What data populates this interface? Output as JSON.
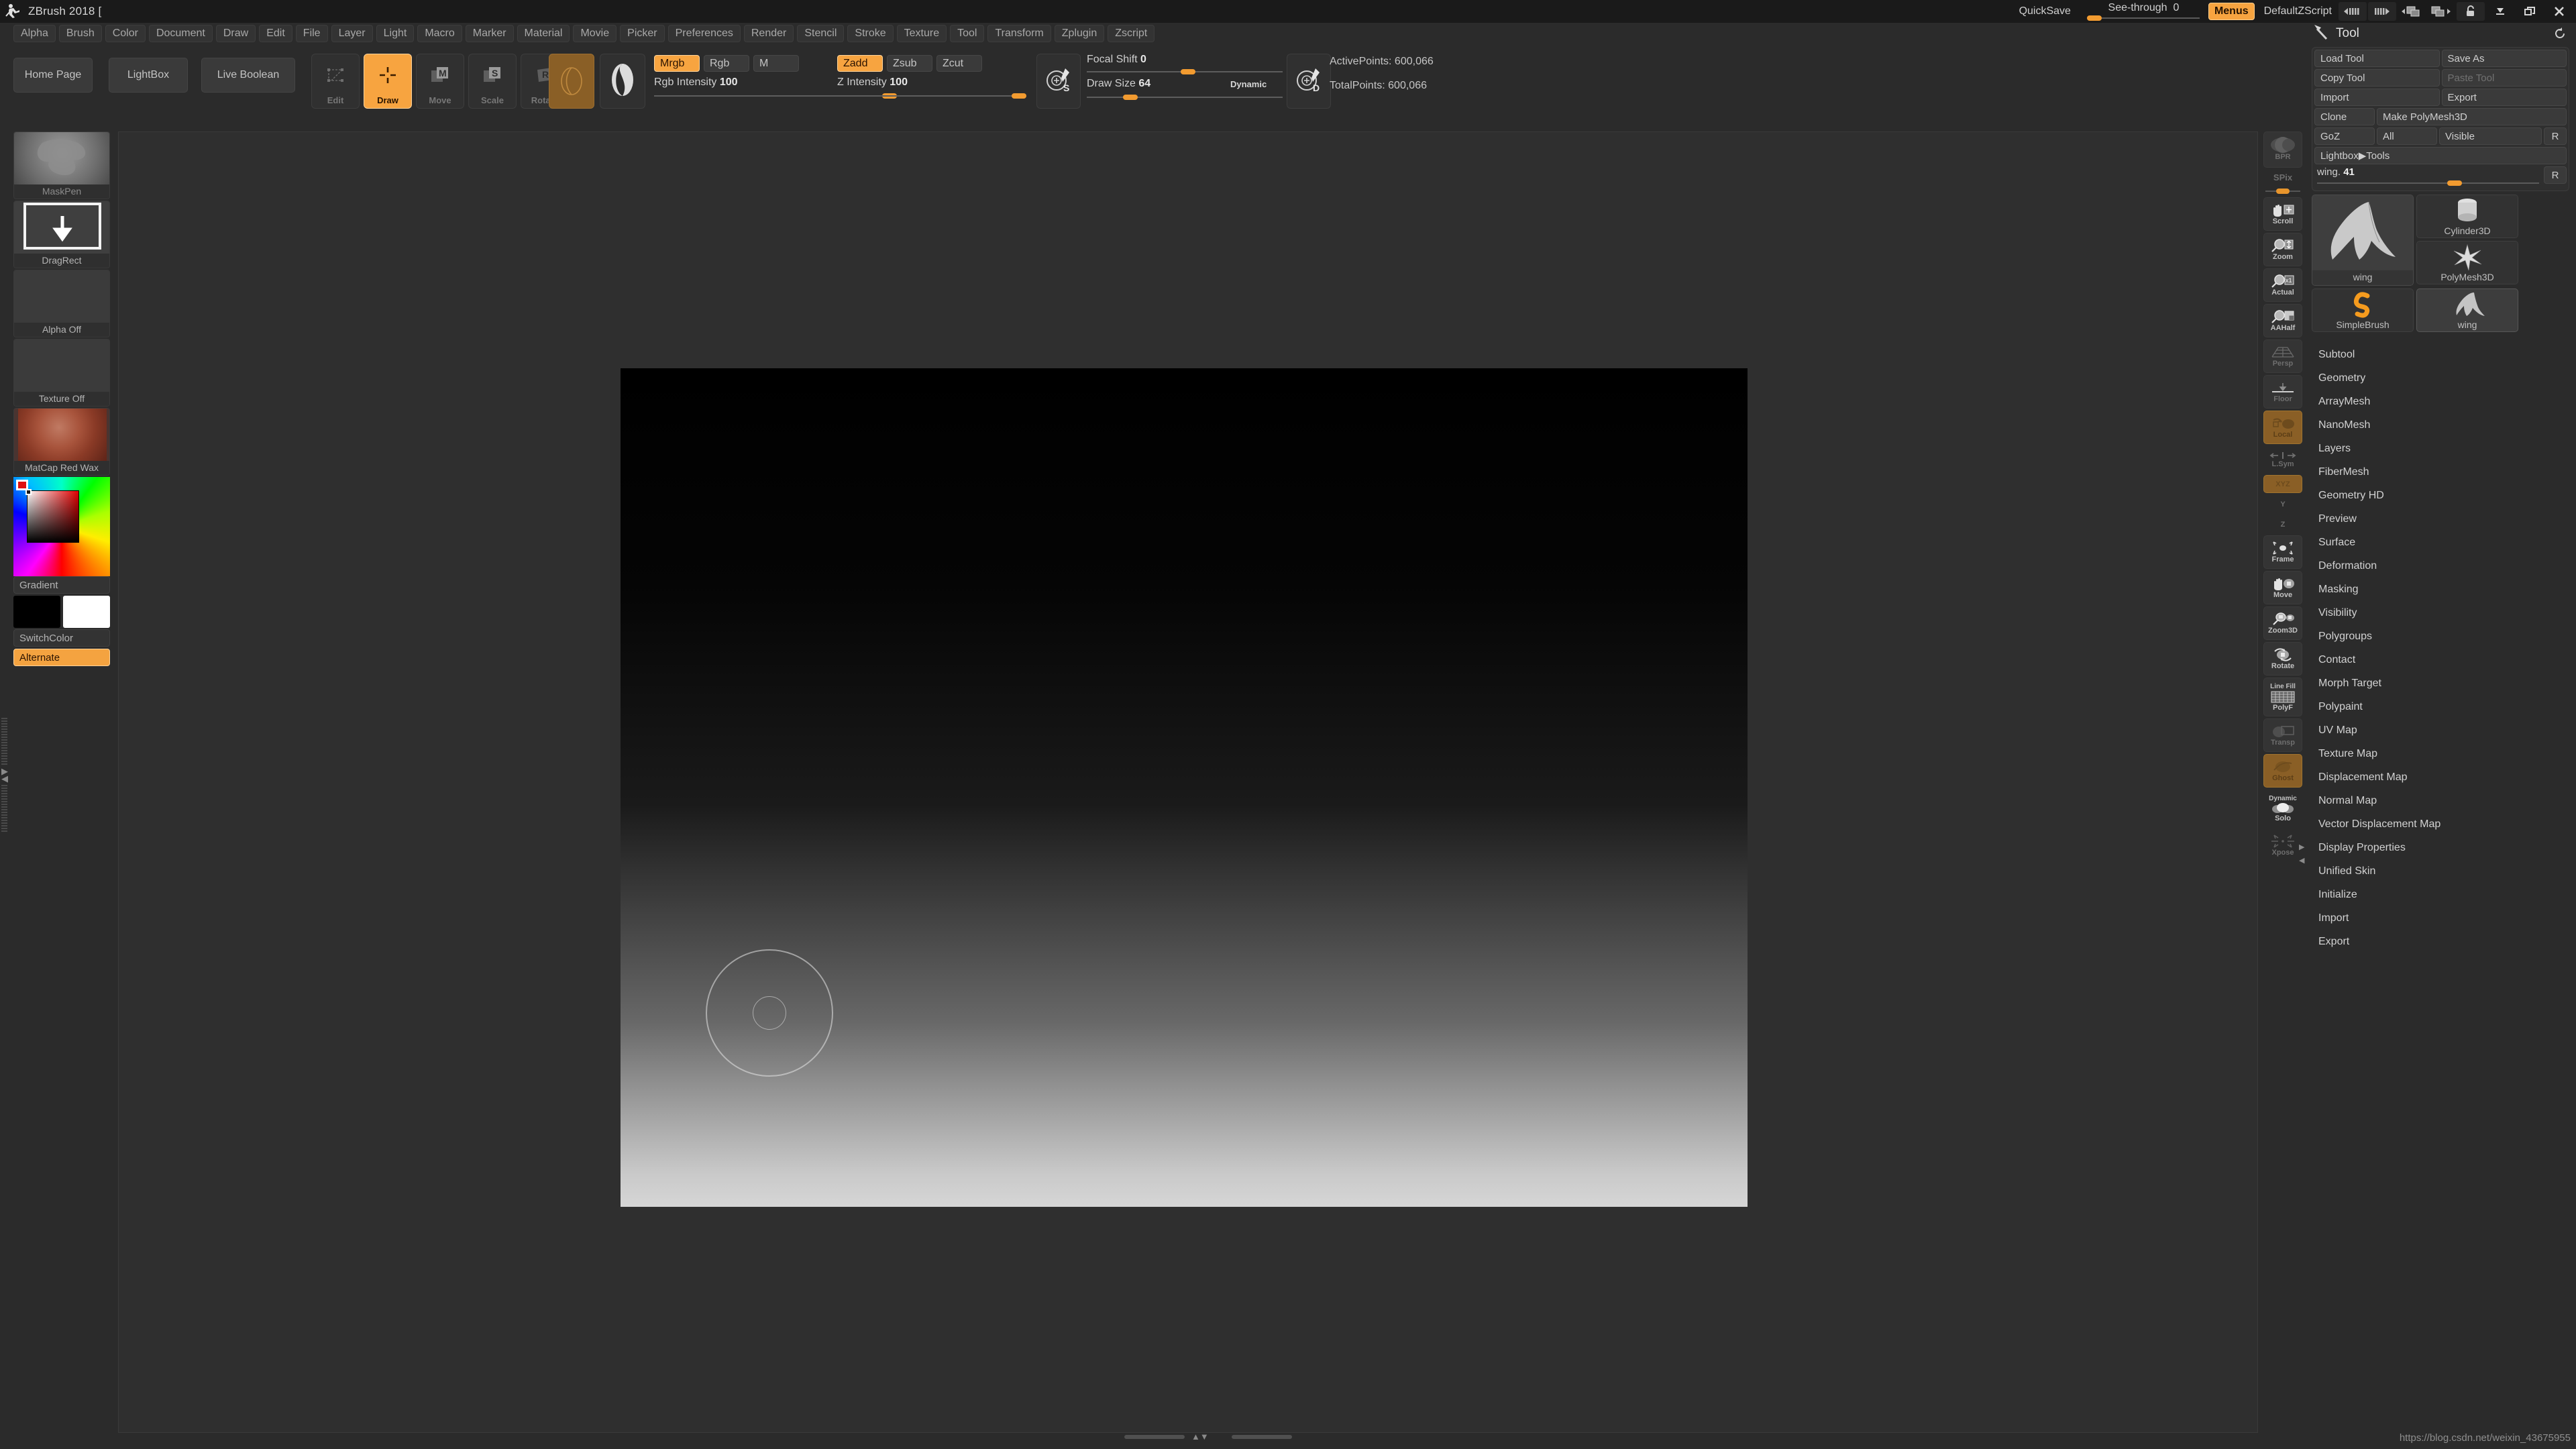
{
  "titlebar": {
    "app_title": "ZBrush 2018 [",
    "logo_icon": "zbrush-runner-logo",
    "quicksave": "QuickSave",
    "see_through_label": "See-through",
    "see_through_value": "0",
    "menus_label": "Menus",
    "default_zscript": "DefaultZScript",
    "window_icons": [
      "prev-shelf-icon",
      "next-shelf-icon",
      "prev-panel-icon",
      "next-panel-icon",
      "lock-icon",
      "minimize-icon",
      "restore-icon",
      "close-icon"
    ]
  },
  "menubar": {
    "items": [
      "Alpha",
      "Brush",
      "Color",
      "Document",
      "Draw",
      "Edit",
      "File",
      "Layer",
      "Light",
      "Macro",
      "Marker",
      "Material",
      "Movie",
      "Picker",
      "Preferences",
      "Render",
      "Stencil",
      "Stroke",
      "Texture",
      "Tool",
      "Transform",
      "Zplugin",
      "Zscript"
    ]
  },
  "shelf": {
    "home_page": "Home Page",
    "lightbox": "LightBox",
    "live_boolean": "Live Boolean",
    "modes": [
      {
        "label": "Edit",
        "icon": "edit-mode-icon",
        "active": false
      },
      {
        "label": "Draw",
        "icon": "draw-mode-icon",
        "active": true
      },
      {
        "label": "Move",
        "icon": "move-mode-icon",
        "active": false
      },
      {
        "label": "Scale",
        "icon": "scale-mode-icon",
        "active": false
      },
      {
        "label": "Rotate",
        "icon": "rotate-mode-icon",
        "active": false
      }
    ],
    "brush_swatch_icon": "current-brush-icon",
    "stroke_swatch_icon": "current-stroke-icon",
    "rgb_toggles": [
      {
        "label": "Mrgb",
        "on": true
      },
      {
        "label": "Rgb",
        "on": false
      },
      {
        "label": "M",
        "on": false
      }
    ],
    "rgb_intensity_label": "Rgb Intensity",
    "rgb_intensity_value": "100",
    "z_toggles": [
      {
        "label": "Zadd",
        "on": true
      },
      {
        "label": "Zsub",
        "on": false
      },
      {
        "label": "Zcut",
        "on": false
      }
    ],
    "z_intensity_label": "Z Intensity",
    "z_intensity_value": "100",
    "focal_shift_label": "Focal Shift",
    "focal_shift_value": "0",
    "draw_size_label": "Draw Size",
    "draw_size_value": "64",
    "dynamic_label": "Dynamic",
    "s_icon": "brush-size-s-icon",
    "d_icon": "brush-size-d-icon",
    "active_points": "ActivePoints: 600,066",
    "total_points": "TotalPoints: 600,066"
  },
  "left_palette": {
    "items": [
      {
        "name": "MaskPen",
        "icon": "brush-thumb-maskpen",
        "dim": true
      },
      {
        "name": "DragRect",
        "icon": "stroke-thumb-dragrect",
        "dim": false
      },
      {
        "name": "Alpha Off",
        "icon": "alpha-thumb-off",
        "dim": false
      },
      {
        "name": "Texture Off",
        "icon": "texture-thumb-off",
        "dim": false
      },
      {
        "name": "MatCap Red Wax",
        "icon": "material-thumb-matcap-red-wax",
        "dim": false
      }
    ],
    "color_picker_icon": "color-picker-swatch",
    "gradient_label": "Gradient",
    "swatch_main": "#000000",
    "swatch_secondary": "#ffffff",
    "switch_color_label": "SwitchColor",
    "alternate_label": "Alternate"
  },
  "canvas": {
    "brush_cursor_icon": "brush-cursor-ring",
    "scrollbar_icon": "horizontal-scrollbar",
    "nav_arrows_icon": "canvas-nav-arrows"
  },
  "right_shelf": {
    "bpr_label": "BPR",
    "spix_label": "SPix",
    "items": [
      {
        "label": "Scroll",
        "icon": "scroll-icon",
        "state": "normal"
      },
      {
        "label": "Zoom",
        "icon": "zoom-icon",
        "state": "normal"
      },
      {
        "label": "Actual",
        "icon": "actual-size-icon",
        "state": "normal"
      },
      {
        "label": "AAHalf",
        "icon": "aahalf-icon",
        "state": "normal"
      },
      {
        "label": "Persp",
        "icon": "perspective-icon",
        "state": "dim"
      },
      {
        "label": "Floor",
        "icon": "floor-grid-icon",
        "state": "dim"
      },
      {
        "label": "Local",
        "icon": "local-symmetry-icon",
        "state": "ochre"
      },
      {
        "label": "L.Sym",
        "icon": "local-sym-icon",
        "state": "dim"
      },
      {
        "label": "XYZ",
        "icon": "xyz-axis-icon",
        "state": "ochre"
      },
      {
        "label": "Y",
        "icon": "y-axis-icon",
        "state": "dim"
      },
      {
        "label": "Z",
        "icon": "z-axis-icon",
        "state": "dim"
      },
      {
        "label": "Frame",
        "icon": "frame-icon",
        "state": "normal"
      },
      {
        "label": "Move",
        "icon": "move-nav-icon",
        "state": "normal"
      },
      {
        "label": "Zoom3D",
        "icon": "zoom3d-icon",
        "state": "normal"
      },
      {
        "label": "Rotate",
        "icon": "rotate-nav-icon",
        "state": "normal"
      },
      {
        "label": "PolyF",
        "icon": "polyframe-icon",
        "state": "normal",
        "sublabel": "Line Fill"
      },
      {
        "label": "Transp",
        "icon": "transparency-icon",
        "state": "dim"
      },
      {
        "label": "Ghost",
        "icon": "ghost-icon",
        "state": "ochre"
      },
      {
        "label": "Solo",
        "icon": "solo-icon",
        "state": "normal",
        "sublabel": "Dynamic"
      },
      {
        "label": "Xpose",
        "icon": "xpose-icon",
        "state": "dim"
      }
    ]
  },
  "tool_panel": {
    "title": "Tool",
    "title_icon": "tool-hammer-icon",
    "reset_icon": "reset-palette-icon",
    "buttons": {
      "load_tool": "Load Tool",
      "save_as": "Save As",
      "copy_tool": "Copy Tool",
      "paste_tool": "Paste Tool",
      "import": "Import",
      "export": "Export",
      "clone": "Clone",
      "make_polymesh3d": "Make PolyMesh3D",
      "goz": "GoZ",
      "all": "All",
      "visible": "Visible",
      "r_goz": "R",
      "lightbox_tools": "Lightbox▶Tools"
    },
    "item_slider": {
      "label": "wing.",
      "value": "41",
      "r_label": "R"
    },
    "thumbnails": [
      {
        "label": "wing",
        "icon": "tool-thumb-wing-large",
        "selected": true
      },
      {
        "label": "Cylinder3D",
        "icon": "tool-thumb-cylinder3d",
        "selected": false
      },
      {
        "label": "PolyMesh3D",
        "icon": "tool-thumb-polymesh3d-star",
        "selected": false
      },
      {
        "label": "SimpleBrush",
        "icon": "tool-thumb-simplebrush",
        "selected": false
      },
      {
        "label": "wing",
        "icon": "tool-thumb-wing-small",
        "selected": true
      }
    ],
    "subpalettes": [
      "Subtool",
      "Geometry",
      "ArrayMesh",
      "NanoMesh",
      "Layers",
      "FiberMesh",
      "Geometry HD",
      "Preview",
      "Surface",
      "Deformation",
      "Masking",
      "Visibility",
      "Polygroups",
      "Contact",
      "Morph Target",
      "Polypaint",
      "UV Map",
      "Texture Map",
      "Displacement Map",
      "Normal Map",
      "Vector Displacement Map",
      "Display Properties",
      "Unified Skin",
      "Initialize",
      "Import",
      "Export"
    ]
  },
  "watermark": "https://blog.csdn.net/weixin_43675955",
  "colors": {
    "accent_orange": "#f7a440",
    "ochre": "#8a5f26",
    "panel_bg": "#2b2b2b",
    "button_bg": "#3a3a3a",
    "text": "#c8c8c8"
  }
}
